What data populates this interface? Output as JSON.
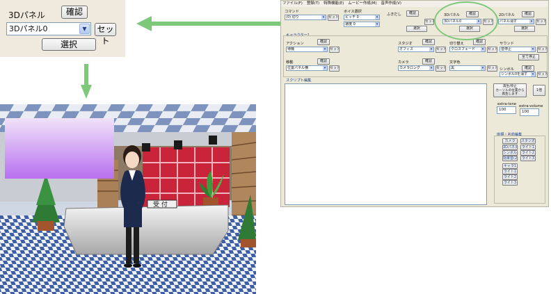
{
  "zoom_panel": {
    "label": "3Dパネル",
    "confirm_button": "確認",
    "select_value": "3Dパネル0",
    "set_button": "セット",
    "choose_button": "選択"
  },
  "scene": {
    "counter_sign": "受 付"
  },
  "app": {
    "menu": [
      "ファイル(F)",
      "登録(T)",
      "特殊機能(E)",
      "ムービー作成(M)",
      "音声作成(V)"
    ],
    "command": {
      "label": "コマンド",
      "value": "(0) 切り"
    },
    "voice": {
      "label": "ボイス選択",
      "value": "ピッチ 0",
      "value2": "速度 0"
    },
    "fukidashi": {
      "label": "ふきだし"
    },
    "panel3d": {
      "label": "3Dパネル",
      "value": "3Dパネル0"
    },
    "panel2d": {
      "label": "2Dパネル",
      "value": "パネル消す"
    },
    "character_group": "キャラクター1",
    "action": {
      "label": "アクション",
      "value": "待機"
    },
    "move": {
      "label": "移動",
      "value": "位置パネル横"
    },
    "studio": {
      "label": "スタジオ",
      "value": "オフィス"
    },
    "switch": {
      "label": "切り替え",
      "value": "クロスフェード"
    },
    "sound": {
      "label": "サウンド",
      "value": "音停止"
    },
    "camera": {
      "label": "カメラ",
      "value": "カメラロング"
    },
    "text_color": {
      "label": "文字色",
      "value": "黒"
    },
    "symbol": {
      "label": "シンボル",
      "value": "シンボル0を消す"
    },
    "script_label": "スクリプト編集",
    "play_button": "再生/停止\nカーソルの位置から\n再生します",
    "speed_button": "1倍",
    "all_stop_button": "全て停止",
    "extra_tone_label": "extra-tone",
    "extra_tone_value": "100",
    "extra_volume_label": "extra-volume",
    "extra_volume_value": "100",
    "coord_group": "座標・名前編集",
    "coord_buttons": [
      "カメラ",
      "スタジオ",
      "3Dパネル",
      "ライト1",
      "シンボル",
      "ライト2",
      "効果音(2)",
      "ライト3"
    ],
    "coord_buttons2": [
      "キャラ1",
      "ライト1",
      "ライト2",
      "ライト3"
    ],
    "confirm": "確認",
    "set": "セット",
    "choose": "選択"
  },
  "colors": {
    "panel_bg": "#efeadd",
    "arrow_green": "#7ec87a",
    "scene_pink": "#d94a5c",
    "overlay_purple": "#c080f0"
  }
}
